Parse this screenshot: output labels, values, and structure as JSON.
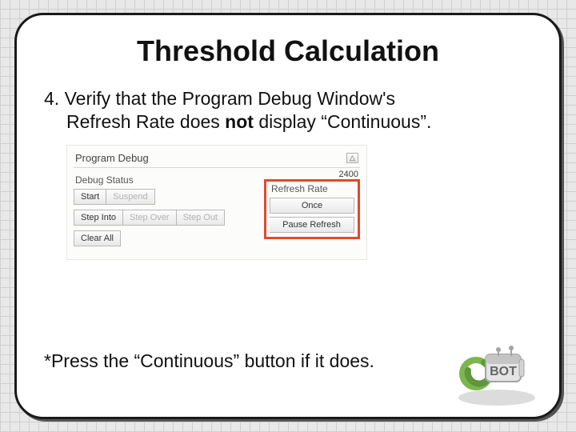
{
  "title": "Threshold Calculation",
  "step": {
    "num": "4.",
    "line1": "Verify that the Program Debug Window's",
    "line2_a": "Refresh Rate does ",
    "line2_strong": "not",
    "line2_b": " display “Continuous”."
  },
  "note": "*Press the “Continuous” button if it does.",
  "panel": {
    "title": "Program Debug",
    "collapse_glyph": "△",
    "timecode": "2400",
    "debug_status_label": "Debug Status",
    "refresh_rate_label": "Refresh Rate",
    "buttons": {
      "start": "Start",
      "suspend": "Suspend",
      "step_into": "Step Into",
      "step_over": "Step Over",
      "step_out": "Step Out",
      "clear_all": "Clear All",
      "once": "Once",
      "pause_refresh": "Pause Refresh"
    }
  }
}
